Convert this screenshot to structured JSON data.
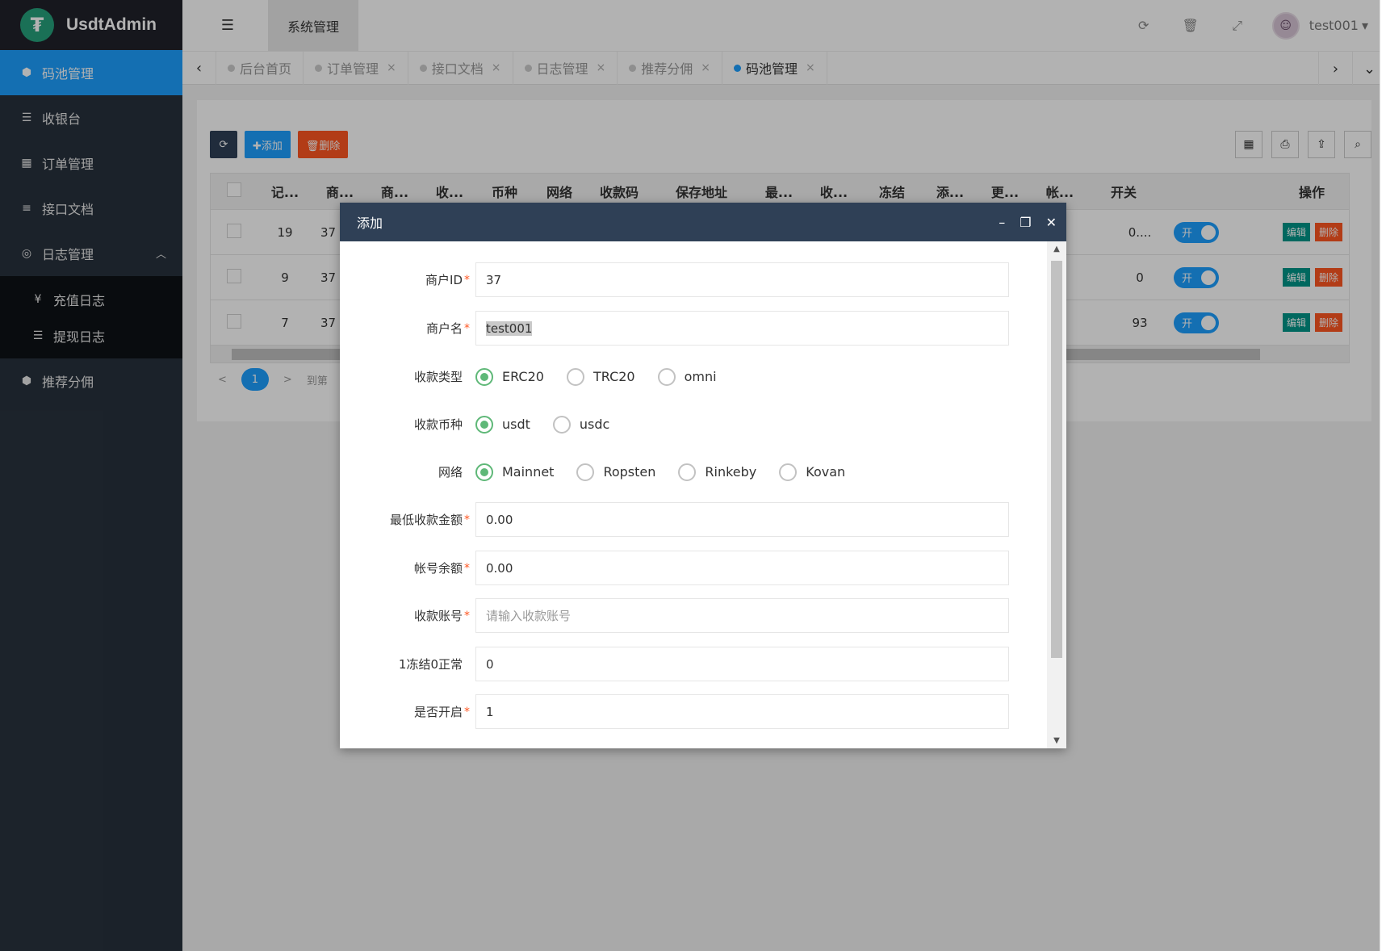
{
  "app": {
    "title": "UsdtAdmin",
    "logo_glyph": "₮"
  },
  "sidebar": {
    "items": [
      {
        "label": "码池管理",
        "icon": "android-icon",
        "glyph": "⬢",
        "active": true
      },
      {
        "label": "收银台",
        "icon": "list-icon",
        "glyph": "☰"
      },
      {
        "label": "订单管理",
        "icon": "calculator-icon",
        "glyph": "▦"
      },
      {
        "label": "接口文档",
        "icon": "align-left-icon",
        "glyph": "≡"
      },
      {
        "label": "日志管理",
        "icon": "dribbble-icon",
        "glyph": "◎",
        "expanded": true,
        "caret": "︿"
      }
    ],
    "sub_items": [
      {
        "label": "充值日志",
        "icon": "yen-icon",
        "glyph": "¥"
      },
      {
        "label": "提现日志",
        "icon": "list-icon",
        "glyph": "☰"
      }
    ],
    "last_item": {
      "label": "推荐分佣",
      "icon": "android-icon",
      "glyph": "⬢"
    }
  },
  "header": {
    "menu_glyph": "☰",
    "tab": "系统管理",
    "icons": {
      "refresh": "⟳",
      "trash": "🗑",
      "fullscreen": "⤢"
    },
    "avatar_glyph": "☺",
    "user": "test001",
    "user_caret": "▾"
  },
  "tabs": {
    "prev": "‹",
    "next": "›",
    "more": "⌄",
    "close_glyph": "×",
    "items": [
      {
        "label": "后台首页"
      },
      {
        "label": "订单管理"
      },
      {
        "label": "接口文档"
      },
      {
        "label": "日志管理"
      },
      {
        "label": "推荐分佣"
      },
      {
        "label": "码池管理",
        "active": true
      }
    ]
  },
  "toolbar": {
    "refresh_glyph": "⟳",
    "add_label": "✚添加",
    "delete_label": "🗑删除",
    "right_icons": [
      "▦",
      "⎙",
      "⇪",
      "⌕"
    ]
  },
  "table": {
    "headers": [
      "记...",
      "商...",
      "商...",
      "收...",
      "币种",
      "网络",
      "收款码",
      "保存地址",
      "最...",
      "收...",
      "冻结",
      "添...",
      "更...",
      "帐...",
      "开关",
      "操作"
    ],
    "rows": [
      {
        "id": "19",
        "merchant": "37",
        "balance": "0....",
        "switch": "开"
      },
      {
        "id": "9",
        "merchant": "37",
        "balance": "0",
        "switch": "开"
      },
      {
        "id": "7",
        "merchant": "37",
        "balance": "93",
        "switch": "开"
      }
    ],
    "edit_label": "编辑",
    "delete_label": "删除"
  },
  "pager": {
    "prev": "<",
    "current": "1",
    "next": ">",
    "goto": "到第"
  },
  "modal": {
    "title": "添加",
    "controls": {
      "minimize": "–",
      "maximize": "❐",
      "close": "✕"
    },
    "scroll_up": "▲",
    "scroll_down": "▼",
    "fields": [
      {
        "label": "商户ID",
        "required": true,
        "value": "37",
        "type": "input"
      },
      {
        "label": "商户名",
        "required": true,
        "value": "test001",
        "type": "input",
        "selected": true
      },
      {
        "label": "收款类型",
        "type": "radio",
        "options": [
          "ERC20",
          "TRC20",
          "omni"
        ],
        "selected": 0
      },
      {
        "label": "收款币种",
        "type": "radio",
        "options": [
          "usdt",
          "usdc"
        ],
        "selected": 0
      },
      {
        "label": "网络",
        "type": "radio",
        "options": [
          "Mainnet",
          "Ropsten",
          "Rinkeby",
          "Kovan"
        ],
        "selected": 0
      },
      {
        "label": "最低收款金额",
        "required": true,
        "value": "0.00",
        "type": "input"
      },
      {
        "label": "帐号余额",
        "required": true,
        "value": "0.00",
        "type": "input"
      },
      {
        "label": "收款账号",
        "required": true,
        "value": "",
        "placeholder": "请输入收款账号",
        "type": "input"
      },
      {
        "label": "1冻结0正常",
        "required": false,
        "value": "0",
        "type": "input"
      },
      {
        "label": "是否开启",
        "required": true,
        "value": "1",
        "type": "input"
      }
    ]
  },
  "colors": {
    "accent": "#1e9fff",
    "sidebar": "#28323d",
    "modal_header": "#2f4056",
    "radio": "#5fb878",
    "danger": "#ff5722",
    "edit": "#009688"
  }
}
